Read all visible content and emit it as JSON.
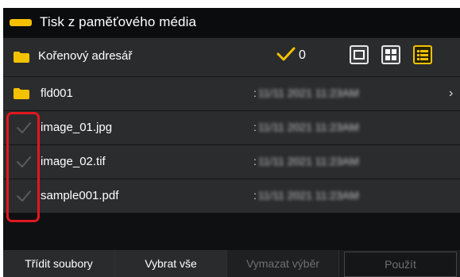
{
  "title": "Tisk z paměťového média",
  "path": {
    "label": "Kořenový adresář",
    "selected_count": "0"
  },
  "view_buttons": [
    {
      "name": "single-view-button",
      "active": false
    },
    {
      "name": "grid-view-button",
      "active": false
    },
    {
      "name": "list-view-button",
      "active": true
    }
  ],
  "rows": [
    {
      "type": "folder",
      "name": "fld001",
      "date": "11/11 2021 11:23AM"
    },
    {
      "type": "file",
      "name": "image_01.jpg",
      "date": "11/11 2021 11:23AM"
    },
    {
      "type": "file",
      "name": "image_02.tif",
      "date": "11/11 2021 11:23AM"
    },
    {
      "type": "file",
      "name": "sample001.pdf",
      "date": "11/11 2021 11:23AM"
    }
  ],
  "buttons": {
    "sort": "Třídit soubory",
    "select_all": "Vybrat vše",
    "clear_selection": "Vymazat výběr",
    "apply": "Použít"
  },
  "colors": {
    "accent": "#f6c000",
    "highlight": "#e2171f"
  }
}
